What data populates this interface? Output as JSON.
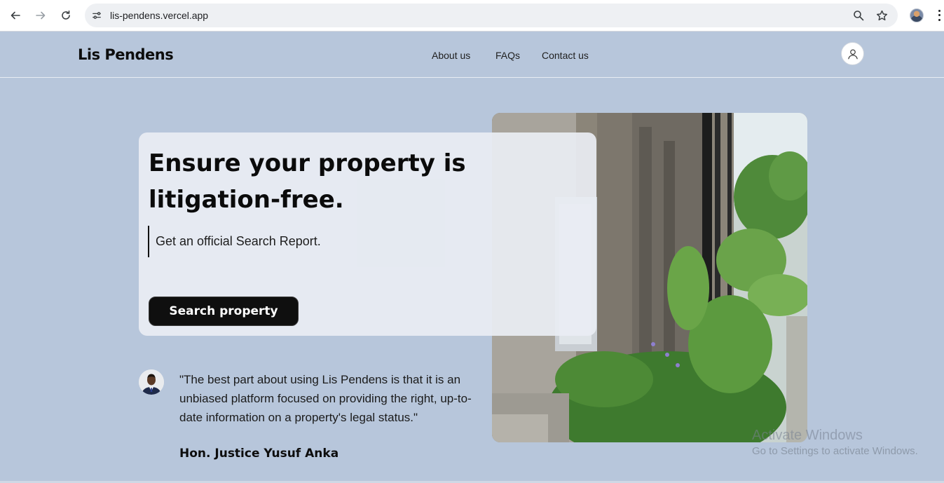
{
  "browser": {
    "url": "lis-pendens.vercel.app",
    "icons": {
      "back": "arrow-left-icon",
      "forward": "arrow-right-icon",
      "reload": "reload-icon",
      "site_info": "tune-icon",
      "zoom": "magnifier-icon",
      "bookmark": "star-icon",
      "menu": "vertical-dots-icon"
    }
  },
  "header": {
    "logo": "Lis Pendens",
    "nav": [
      "About us",
      "FAQs",
      "Contact us"
    ],
    "account_icon": "user-icon"
  },
  "hero": {
    "headline": "Ensure your property is litigation-free.",
    "subline": "Get an official Search Report.",
    "cta_label": "Search property",
    "image": "building-exterior-with-garden-photo"
  },
  "testimonial": {
    "quote": "\"The best part about using Lis Pendens is that it is an unbiased platform focused on providing the right, up-to-date information on a property's legal status.\"",
    "author": "Hon. Justice Yusuf Anka"
  },
  "watermark": {
    "title": "Activate Windows",
    "subtitle": "Go to Settings to activate Windows."
  },
  "colors": {
    "page_bg": "#b7c6db",
    "card_bg": "#e9edf3",
    "cta_bg": "#0f0f0f",
    "text_dark": "#0b0b0b"
  }
}
